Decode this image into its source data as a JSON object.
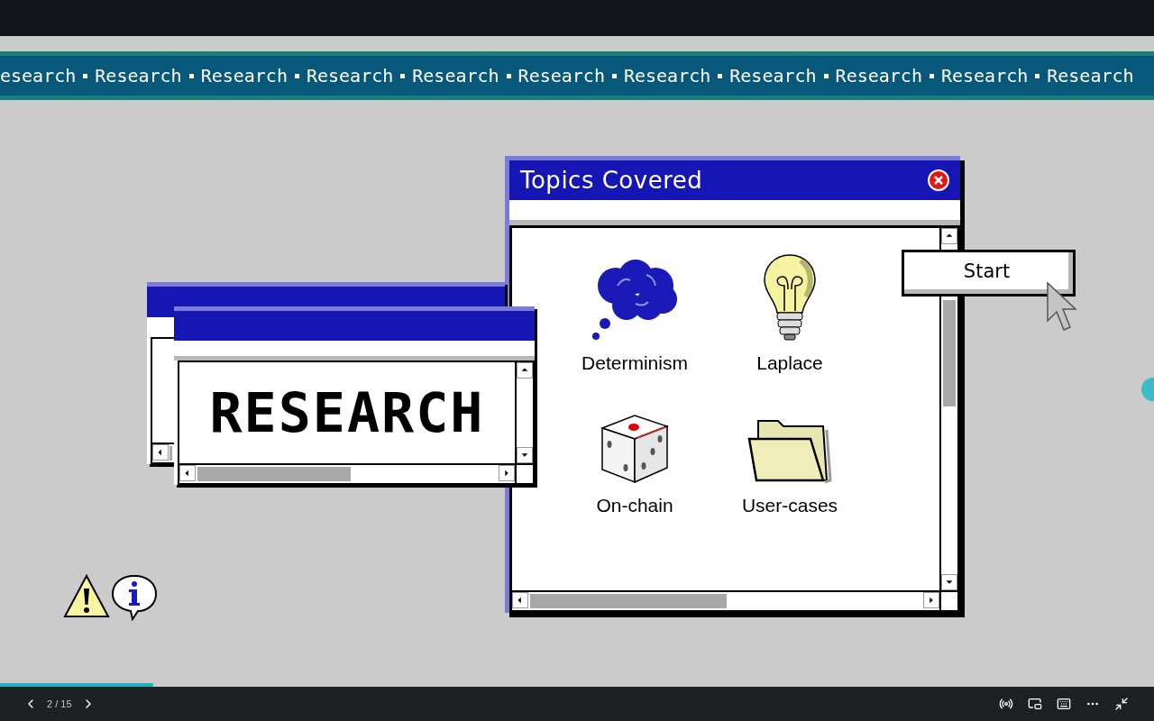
{
  "banner": {
    "items": [
      "esearch",
      "Research",
      "Research",
      "Research",
      "Research",
      "Research",
      "Research",
      "Research",
      "Research",
      "Research",
      "Research"
    ]
  },
  "research_window": {
    "heading": "RESEARCH"
  },
  "topics_window": {
    "title": "Topics Covered",
    "items": [
      {
        "label": "Determinism",
        "kind": "thought"
      },
      {
        "label": "Laplace",
        "kind": "bulb"
      },
      {
        "label": "On-chain",
        "kind": "dice"
      },
      {
        "label": "User-cases",
        "kind": "folder"
      }
    ]
  },
  "start_button": {
    "label": "Start"
  },
  "player": {
    "progress": {
      "level": 0.133
    },
    "page": "2 / 15"
  }
}
